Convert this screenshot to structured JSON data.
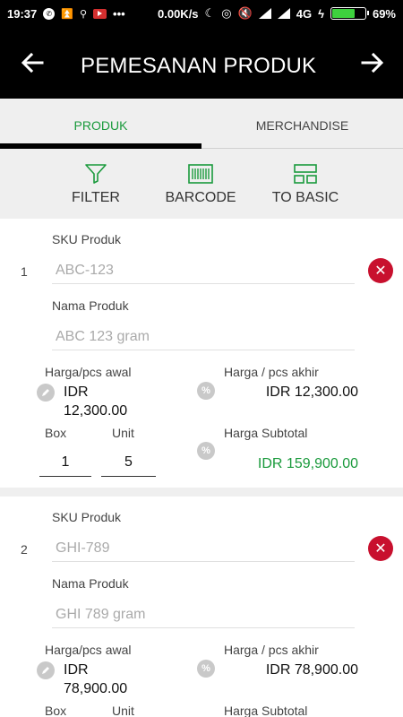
{
  "status_bar": {
    "time": "19:37",
    "net_speed": "0.00K/s",
    "network": "4G",
    "battery_pct": "69%",
    "battery_level": 0.69
  },
  "app_bar": {
    "title": "PEMESANAN PRODUK",
    "back_icon": "arrow-left-icon",
    "forward_icon": "arrow-right-icon"
  },
  "tabs": [
    {
      "label": "PRODUK",
      "active": true
    },
    {
      "label": "MERCHANDISE",
      "active": false
    }
  ],
  "toolbar": [
    {
      "label": "FILTER",
      "icon": "filter-icon"
    },
    {
      "label": "BARCODE",
      "icon": "barcode-icon"
    },
    {
      "label": "TO BASIC",
      "icon": "layout-icon"
    }
  ],
  "colors": {
    "accent_green": "#1a9a3c",
    "remove_red": "#c8102e",
    "bar_black": "#000000"
  },
  "products": [
    {
      "index": "1",
      "sku_label": "SKU Produk",
      "sku_placeholder": "ABC-123",
      "name_label": "Nama Produk",
      "name_placeholder": "ABC 123 gram",
      "price_initial_label": "Harga/pcs awal",
      "price_initial_currency": "IDR",
      "price_initial_value": "12,300.00",
      "price_final_label": "Harga / pcs akhir",
      "price_final": "IDR 12,300.00",
      "box_label": "Box",
      "unit_label": "Unit",
      "box_qty": "1",
      "unit_qty": "5",
      "subtotal_label": "Harga Subtotal",
      "subtotal": "IDR 159,900.00"
    },
    {
      "index": "2",
      "sku_label": "SKU Produk",
      "sku_placeholder": "GHI-789",
      "name_label": "Nama Produk",
      "name_placeholder": "GHI 789 gram",
      "price_initial_label": "Harga/pcs awal",
      "price_initial_currency": "IDR",
      "price_initial_value": "78,900.00",
      "price_final_label": "Harga / pcs akhir",
      "price_final": "IDR 78,900.00",
      "box_label": "Box",
      "unit_label": "Unit",
      "subtotal_label": "Harga Subtotal"
    }
  ]
}
